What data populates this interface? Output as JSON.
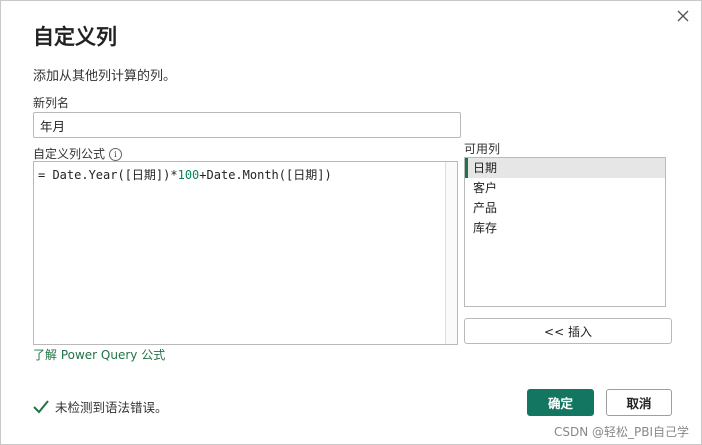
{
  "dialog": {
    "title": "自定义列",
    "subtitle": "添加从其他列计算的列。"
  },
  "new_column": {
    "label": "新列名",
    "value": "年月"
  },
  "formula": {
    "label": "自定义列公式",
    "text_prefix": "= Date.Year([日期])*",
    "text_number": "100",
    "text_suffix": "+Date.Month([日期])"
  },
  "available": {
    "label": "可用列",
    "items": [
      {
        "label": "日期",
        "selected": true
      },
      {
        "label": "客户",
        "selected": false
      },
      {
        "label": "产品",
        "selected": false
      },
      {
        "label": "库存",
        "selected": false
      }
    ],
    "insert_label": "<< 插入"
  },
  "learn_link": "了解 Power Query 公式",
  "status": {
    "text": "未检测到语法错误。",
    "color": "#217346"
  },
  "buttons": {
    "ok_label": "确定",
    "cancel_label": "取消"
  },
  "watermark": "CSDN @轻松_PBI自己学"
}
